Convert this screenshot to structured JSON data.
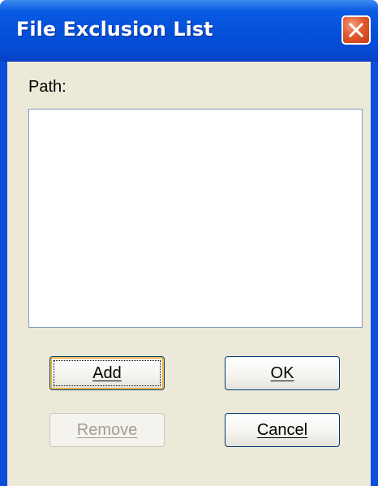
{
  "window": {
    "title": "File Exclusion List"
  },
  "form": {
    "path_label": "Path:"
  },
  "buttons": {
    "add": "Add",
    "ok": "OK",
    "remove": "Remove",
    "cancel": "Cancel"
  },
  "icons": {
    "close": "close-icon"
  },
  "colors": {
    "titlebar": "#0450d8",
    "client_background": "#ece9d8",
    "close_button": "#e2592e"
  }
}
